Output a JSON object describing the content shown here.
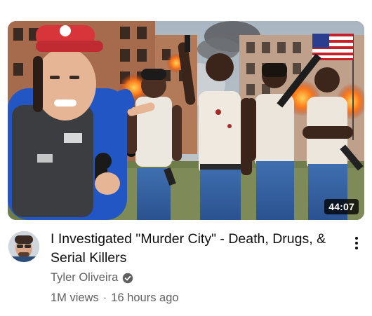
{
  "video": {
    "title": "I Investigated \"Murder City\" - Death, Drugs, & Serial Killers",
    "duration": "44:07",
    "thumbnail_icon": "video-thumbnail"
  },
  "channel": {
    "name": "Tyler Oliveira",
    "verified_icon": "verified-check-icon",
    "avatar_icon": "channel-avatar"
  },
  "stats": {
    "views": "1M views",
    "separator": "·",
    "age": "16 hours ago"
  },
  "menu": {
    "icon": "more-vert-icon"
  },
  "colors": {
    "text_primary": "#0f0f0f",
    "text_secondary": "#606060",
    "duration_bg": "#000000"
  }
}
